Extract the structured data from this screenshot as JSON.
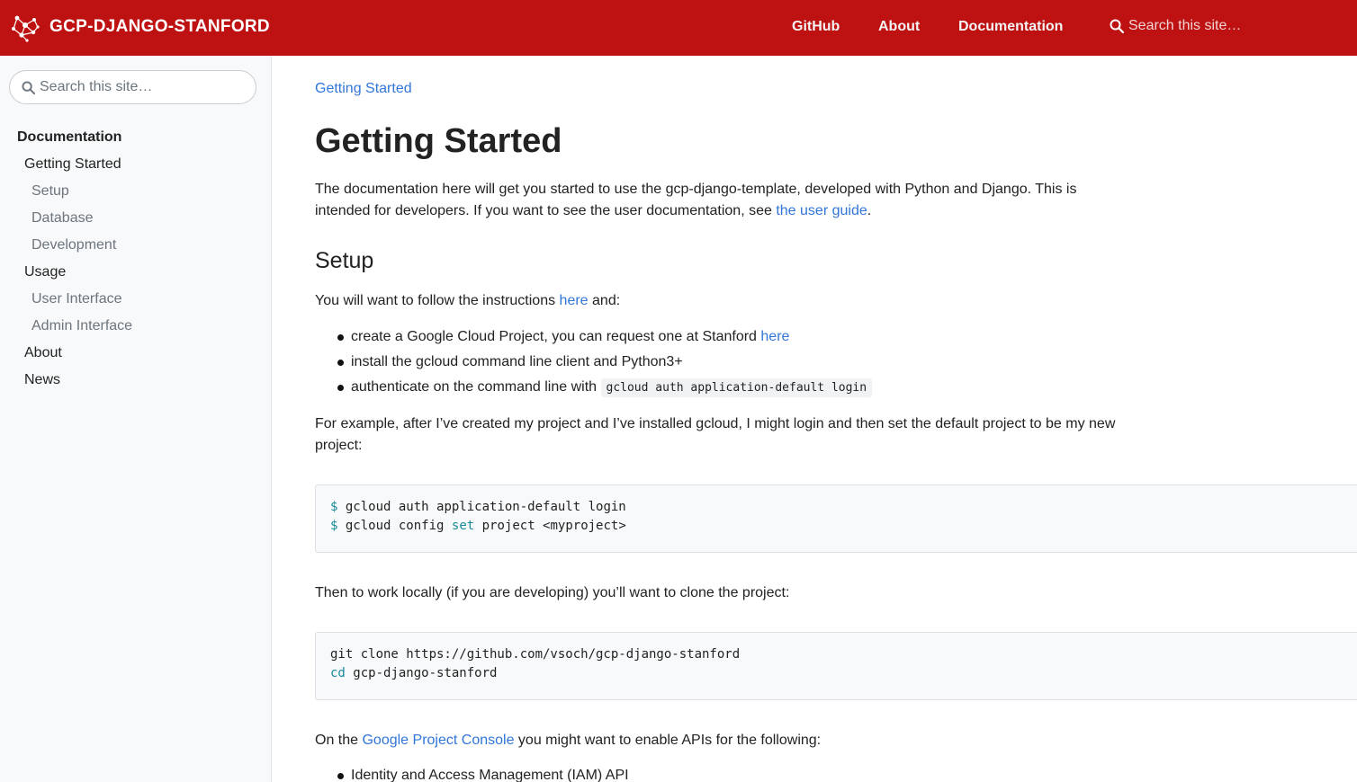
{
  "navbar": {
    "brand": "GCP-DJANGO-STANFORD",
    "links": {
      "github": "GitHub",
      "about": "About",
      "documentation": "Documentation"
    },
    "search_placeholder": "Search this site…",
    "bg_color": "#be1111"
  },
  "sidebar": {
    "search_placeholder": "Search this site…",
    "items": [
      {
        "label": "Documentation",
        "level": 0
      },
      {
        "label": "Getting Started",
        "level": 1
      },
      {
        "label": "Setup",
        "level": 2
      },
      {
        "label": "Database",
        "level": 2
      },
      {
        "label": "Development",
        "level": 2
      },
      {
        "label": "Usage",
        "level": 1
      },
      {
        "label": "User Interface",
        "level": 2
      },
      {
        "label": "Admin Interface",
        "level": 2
      },
      {
        "label": "About",
        "level": 1
      },
      {
        "label": "News",
        "level": 1
      }
    ]
  },
  "main": {
    "breadcrumb": "Getting Started",
    "title": "Getting Started",
    "intro_text": "The documentation here will get you started to use the gcp-django-template, developed with Python and Django. This is intended for developers. If you want to see the user documentation, see ",
    "intro_link": "the user guide",
    "intro_end": ".",
    "setup_heading": "Setup",
    "setup_text": "You will want to follow the instructions ",
    "setup_link": "here",
    "setup_end": " and:",
    "bullets": {
      "b1_text": "create a Google Cloud Project, you can request one at Stanford ",
      "b1_link": "here",
      "b2_text": "install the gcloud command line client and Python3+",
      "b3_text": "authenticate on the command line with ",
      "b3_code": "gcloud auth application-default login"
    },
    "example_text": "For example, after I’ve created my project and I’ve installed gcloud, I might login and then set the default project to be my new project:",
    "code1": {
      "prompt": "$",
      "line1": "gcloud auth application-default login",
      "line2_cmd": "gcloud config",
      "line2_kw": "set",
      "line2_rest": "project <myproject>"
    },
    "clone_text": "Then to work locally (if you are developing) you’ll want to clone the project:",
    "code2": {
      "line1": "git clone https://github.com/vsoch/gcp-django-stanford",
      "line2_kw": "cd",
      "line2_rest": "gcp-django-stanford"
    },
    "console_text_start": "On the ",
    "console_link": "Google Project Console",
    "console_text_end": " you might want to enable APIs for the following:",
    "api_bullet": "Identity and Access Management (IAM) API"
  }
}
